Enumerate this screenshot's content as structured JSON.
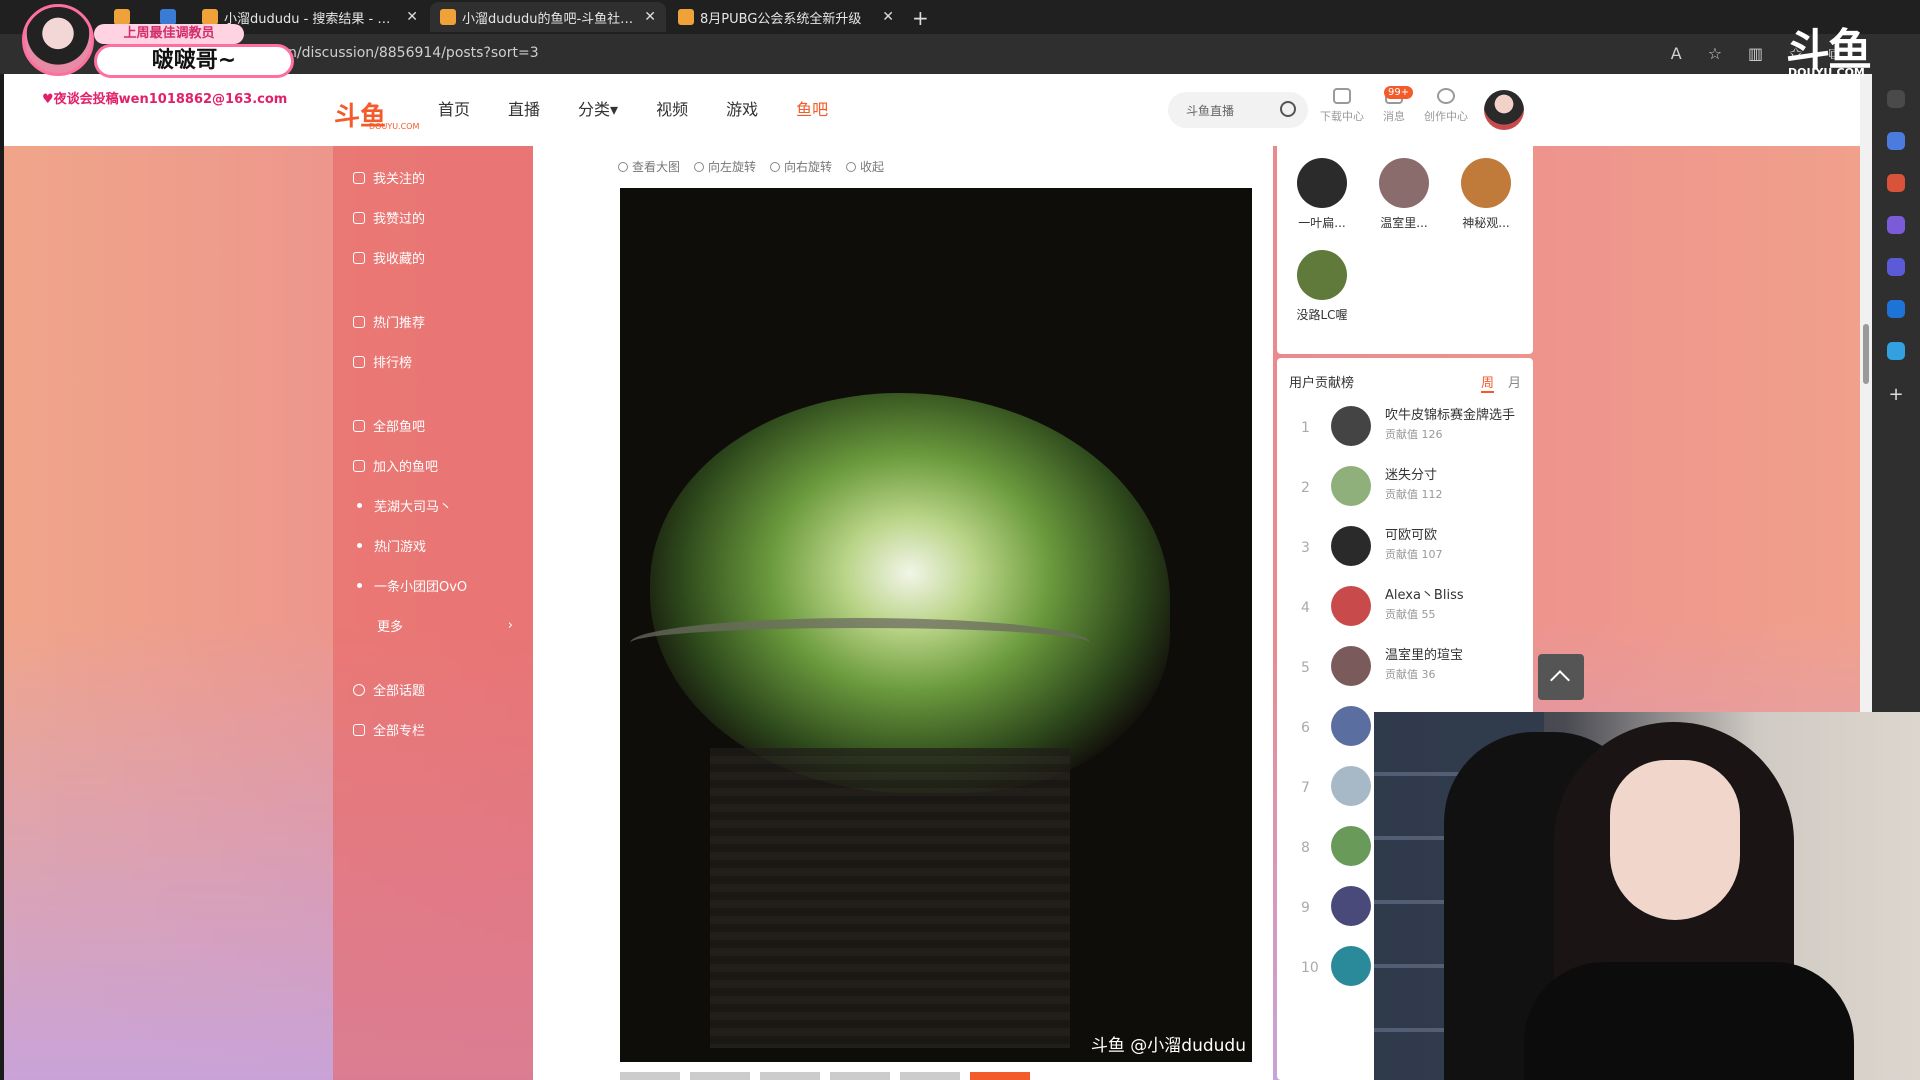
{
  "browser": {
    "tabs": [
      {
        "title": "",
        "active": false,
        "left": 0
      },
      {
        "title": "小溜dududu - 搜索结果 - 斗鱼直",
        "active": false
      },
      {
        "title": "小溜dududu的鱼吧-斗鱼社区,直",
        "active": true
      },
      {
        "title": "8月PUBG公会系统全新升级",
        "active": false
      }
    ],
    "url": "n/discussion/8856914/posts?sort=3"
  },
  "overlay": {
    "badge": "上周最佳调教员",
    "name": "啵啵哥~",
    "email": "♥夜谈会投稿wen1018862@163.com"
  },
  "site": {
    "logo": "斗鱼",
    "logo_sub": "DOUYU.COM",
    "nav": [
      "首页",
      "直播",
      "分类▾",
      "视频",
      "游戏",
      "鱼吧"
    ],
    "search_placeholder": "斗鱼直播",
    "header_buttons": [
      "下载中心",
      "消息",
      "创作中心"
    ],
    "msg_badge": "99+"
  },
  "sidebar": {
    "items": [
      {
        "label": "我关注的",
        "type": "icon"
      },
      {
        "label": "我赞过的",
        "type": "icon"
      },
      {
        "label": "我收藏的",
        "type": "icon"
      },
      {
        "label": "热门推荐",
        "type": "icon"
      },
      {
        "label": "排行榜",
        "type": "icon"
      },
      {
        "label": "全部鱼吧",
        "type": "icon"
      },
      {
        "label": "加入的鱼吧",
        "type": "icon"
      },
      {
        "label": "芜湖大司马丶",
        "type": "dot"
      },
      {
        "label": "热门游戏",
        "type": "dot"
      },
      {
        "label": "一条小团团OvO",
        "type": "dot"
      },
      {
        "label": "更多",
        "type": "more"
      },
      {
        "label": "全部话题",
        "type": "icon"
      },
      {
        "label": "全部专栏",
        "type": "icon"
      }
    ]
  },
  "viewer": {
    "toolbar": [
      "查看大图",
      "向左旋转",
      "向右旋转",
      "收起"
    ],
    "watermark": "斗鱼 @小溜dududu"
  },
  "fans": [
    {
      "name": "一叶扁...",
      "color": "#2b2b2b"
    },
    {
      "name": "温室里...",
      "color": "#8a6c6c"
    },
    {
      "name": "神秘观...",
      "color": "#c07a3a"
    },
    {
      "name": "没路LC喔",
      "color": "#5f7a3a"
    }
  ],
  "rank": {
    "title": "用户贡献榜",
    "tab_week": "周",
    "tab_month": "月",
    "rows": [
      {
        "num": "1",
        "name": "吹牛皮锦标赛金牌选手",
        "score": "贡献值 126",
        "color": "#444"
      },
      {
        "num": "2",
        "name": "迷失分寸",
        "score": "贡献值 112",
        "color": "#8fb07a"
      },
      {
        "num": "3",
        "name": "可欧可欧",
        "score": "贡献值 107",
        "color": "#2a2a2a"
      },
      {
        "num": "4",
        "name": "Alexa丶Bliss",
        "score": "贡献值 55",
        "color": "#c94a4a"
      },
      {
        "num": "5",
        "name": "温室里的瑄宝",
        "score": "贡献值 36",
        "color": "#7a5a5a"
      },
      {
        "num": "6",
        "name": "",
        "score": "",
        "color": "#5a6fa0"
      },
      {
        "num": "7",
        "name": "",
        "score": "",
        "color": "#a7b9c7"
      },
      {
        "num": "8",
        "name": "",
        "score": "",
        "color": "#6a9a5a"
      },
      {
        "num": "9",
        "name": "",
        "score": "",
        "color": "#4a4a7a"
      },
      {
        "num": "10",
        "name": "",
        "score": "",
        "color": "#2a8a9a"
      }
    ]
  },
  "corner_logo": {
    "text": "斗鱼",
    "sub": "DOUYU.COM"
  }
}
